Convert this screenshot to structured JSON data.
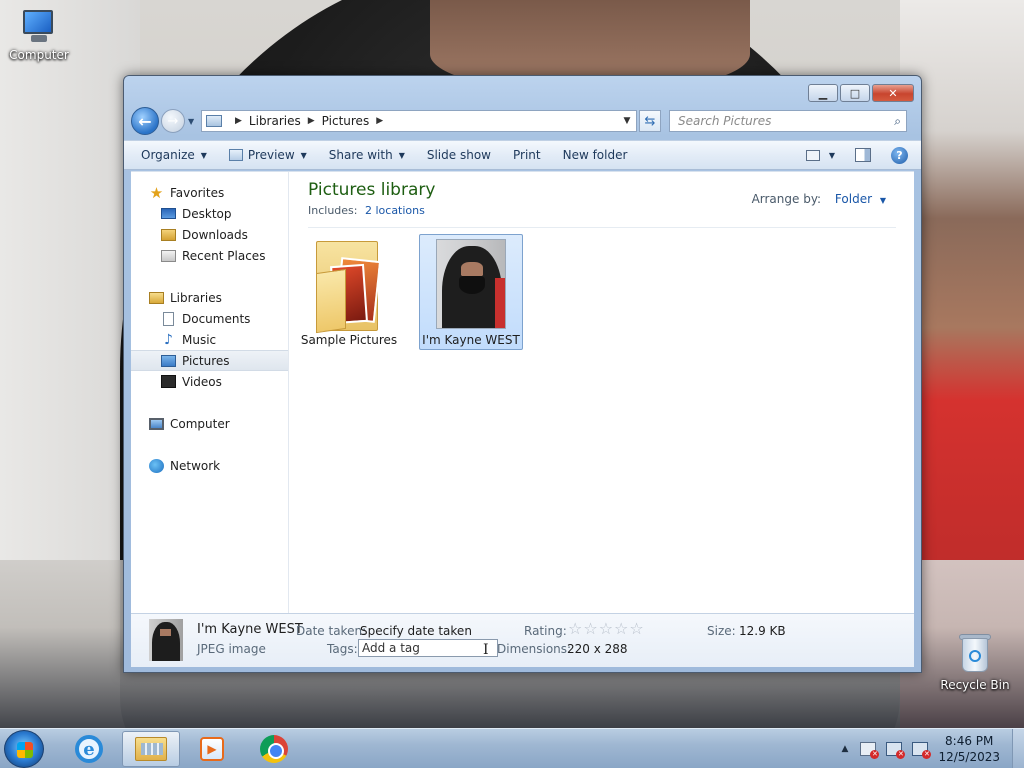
{
  "desktop": {
    "icons": {
      "computer": "Computer",
      "recycle_bin": "Recycle Bin"
    }
  },
  "window": {
    "caption_buttons": {
      "minimize": "▁",
      "maximize": "□",
      "close": "✕"
    },
    "address": {
      "crumbs": [
        "Libraries",
        "Pictures"
      ],
      "crumb_separator": "▶"
    },
    "search": {
      "placeholder": "Search Pictures"
    },
    "toolbar": {
      "organize": "Organize",
      "preview": "Preview",
      "share_with": "Share with",
      "slide_show": "Slide show",
      "print": "Print",
      "new_folder": "New folder"
    },
    "nav_pane": {
      "favorites": "Favorites",
      "desktop": "Desktop",
      "downloads": "Downloads",
      "recent_places": "Recent Places",
      "libraries": "Libraries",
      "documents": "Documents",
      "music": "Music",
      "pictures": "Pictures",
      "videos": "Videos",
      "computer": "Computer",
      "network": "Network"
    },
    "library": {
      "title": "Pictures library",
      "includes_label": "Includes:",
      "includes_link": "2 locations",
      "arrange_label": "Arrange by:",
      "arrange_value": "Folder"
    },
    "items": [
      {
        "name": "Sample Pictures",
        "type": "folder",
        "selected": false
      },
      {
        "name": "I'm Kayne WEST",
        "type": "image",
        "selected": true
      }
    ],
    "details": {
      "name": "I'm Kayne WEST",
      "type": "JPEG image",
      "date_taken_label": "Date taken:",
      "date_taken_value": "Specify date taken",
      "tags_label": "Tags:",
      "tags_value": "Add a tag",
      "rating_label": "Rating:",
      "rating": 0,
      "rating_stars": "☆☆☆☆☆",
      "dimensions_label": "Dimensions:",
      "dimensions_value": "220 x 288",
      "size_label": "Size:",
      "size_value": "12.9 KB"
    }
  },
  "taskbar": {
    "apps": [
      "internet-explorer",
      "windows-explorer",
      "windows-media-player",
      "google-chrome"
    ],
    "active_app": "windows-explorer",
    "clock": {
      "time": "8:46 PM",
      "date": "12/5/2023"
    }
  }
}
